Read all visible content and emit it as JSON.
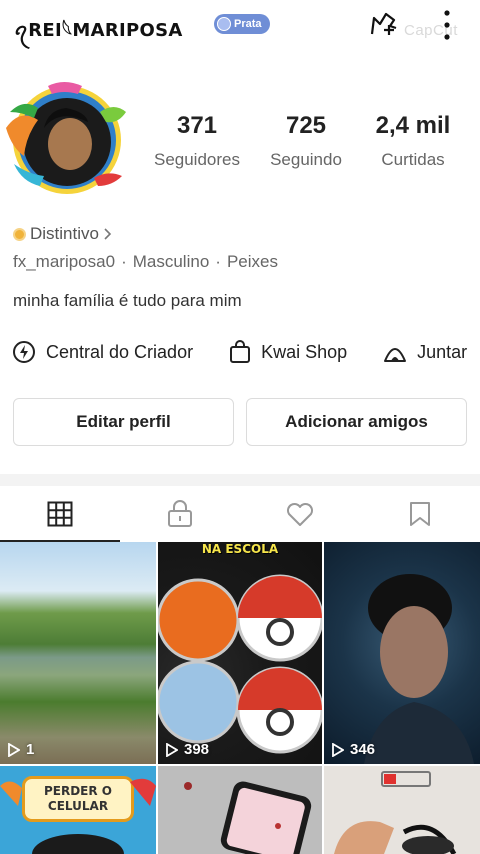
{
  "header": {
    "username": "ꪖREI𓆩MARIPOSA",
    "badge_label": "Prata",
    "watermark": "CapCut"
  },
  "stats": [
    {
      "value": "371",
      "label": "Seguidores"
    },
    {
      "value": "725",
      "label": "Seguindo"
    },
    {
      "value": "2,4 mil",
      "label": "Curtidas"
    }
  ],
  "profile": {
    "distintivo": "Distintivo",
    "handle": "fx_mariposa0",
    "gender": "Masculino",
    "sign": "Peixes",
    "bio": "minha família é tudo para mim"
  },
  "links": [
    {
      "label": "Central do Criador",
      "icon": "lightning-icon"
    },
    {
      "label": "Kwai Shop",
      "icon": "shopping-bag-icon"
    },
    {
      "label": "Juntar",
      "icon": "tent-icon"
    }
  ],
  "buttons": {
    "edit": "Editar perfil",
    "add": "Adicionar amigos"
  },
  "tabs": [
    {
      "icon": "grid-icon",
      "active": true
    },
    {
      "icon": "lock-icon",
      "active": false
    },
    {
      "icon": "heart-icon",
      "active": false
    },
    {
      "icon": "bookmark-icon",
      "active": false
    }
  ],
  "videos": [
    {
      "plays": "1"
    },
    {
      "plays": "398",
      "cover_text": "NA ESCOLA"
    },
    {
      "plays": "346"
    },
    {
      "cover_text": "PERDER O CELULAR"
    },
    {},
    {}
  ]
}
